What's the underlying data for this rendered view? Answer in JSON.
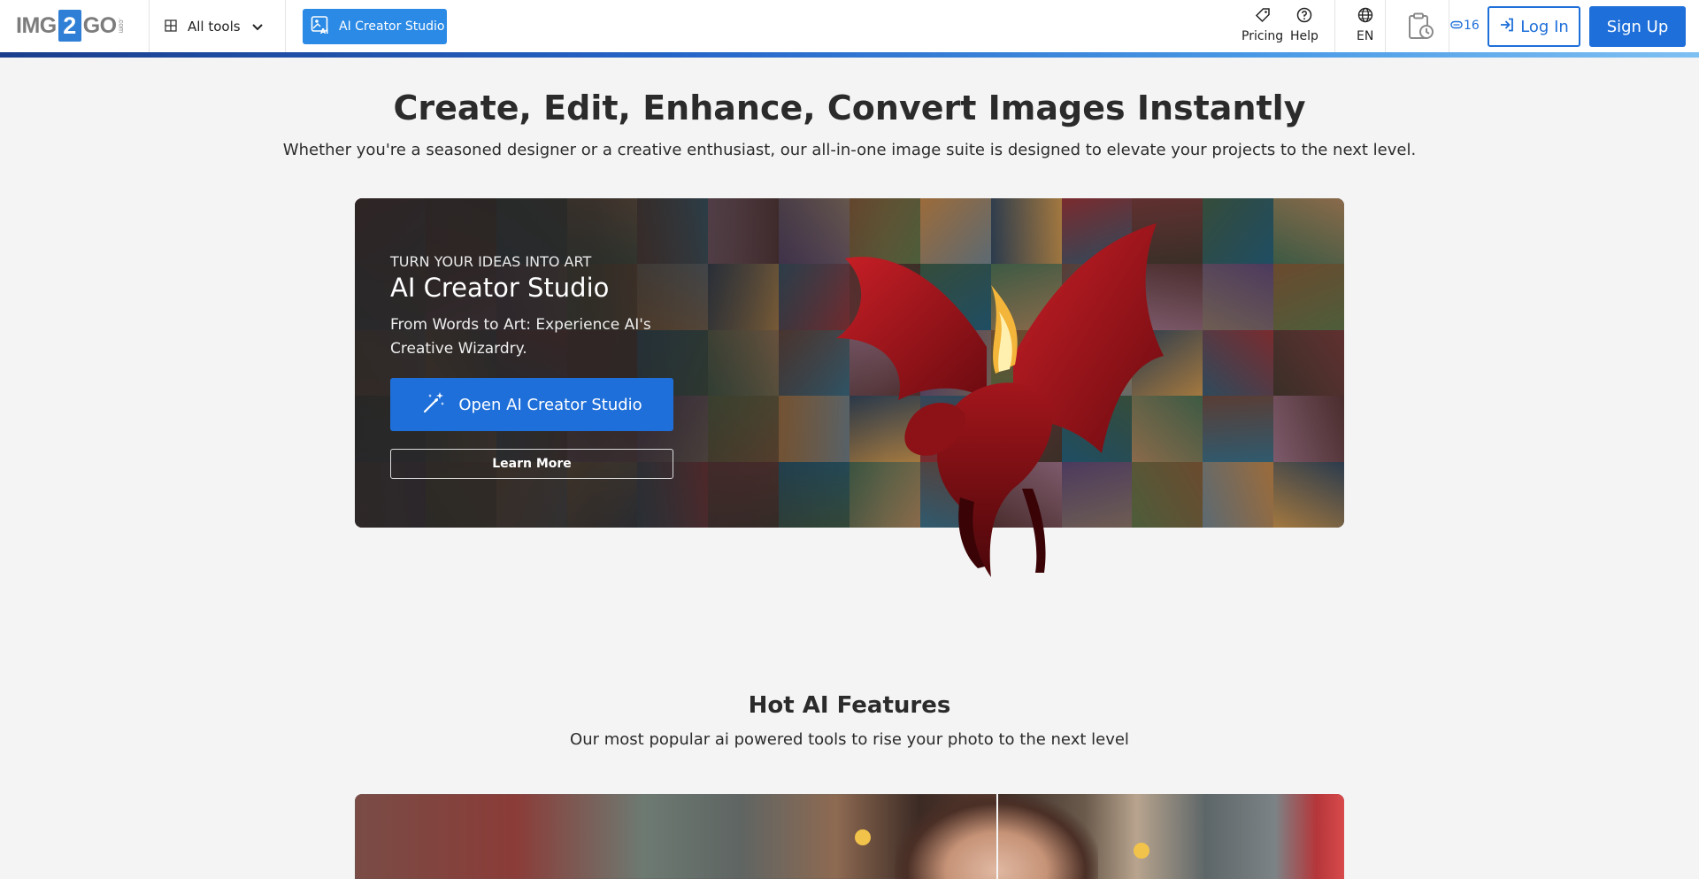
{
  "nav": {
    "logo_left": "IMG",
    "logo_mid": "2",
    "logo_right": "GO",
    "logo_suffix": ".com",
    "all_tools_label": "All tools",
    "ai_studio_label": "AI Creator Studio",
    "pricing_label": "Pricing",
    "help_label": "Help",
    "language_label": "EN",
    "credits_count": "16",
    "login_label": "Log In",
    "signup_label": "Sign Up",
    "colors": {
      "primary": "#1e6fd9",
      "studio_button": "#2b8ae5"
    }
  },
  "hero": {
    "title": "Create, Edit, Enhance, Convert Images Instantly",
    "subtitle": "Whether you're a seasoned designer or a creative enthusiast, our all-in-one image suite is designed to elevate your projects to the next level."
  },
  "banner": {
    "kicker": "TURN YOUR IDEAS INTO ART",
    "title": "AI Creator Studio",
    "description": "From Words to Art: Experience AI's Creative Wizardry.",
    "open_button": "Open AI Creator Studio",
    "learn_more_button": "Learn More"
  },
  "hot_features": {
    "title": "Hot AI Features",
    "subtitle": "Our most popular ai powered tools to rise your photo to the next level"
  }
}
